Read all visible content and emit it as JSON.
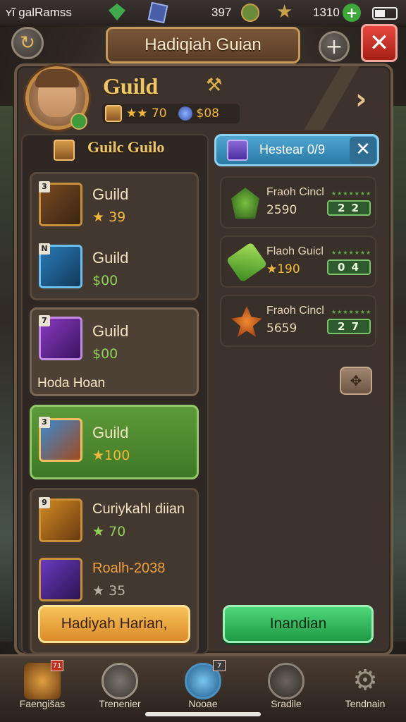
{
  "status_bar": {
    "app_name": "ʏĩ galRamss",
    "stat1": "397",
    "stat2": "1310"
  },
  "header": {
    "title": "Hadiqiah Guian"
  },
  "profile": {
    "title": "Guild",
    "stars_value": "★★ 70",
    "coins_value": "$08"
  },
  "left_section": {
    "heading": "Guilc Guilo",
    "items": [
      {
        "level": "3",
        "name": "Guild",
        "price": "★ 39"
      },
      {
        "level": "N",
        "name": "Guild",
        "price": "$00"
      },
      {
        "level": "7",
        "name": "Guild",
        "price": "$00",
        "subtitle": "Hoda Hoan"
      },
      {
        "level": "3",
        "name": "Guild",
        "price": "★100"
      },
      {
        "level": "9",
        "name": "Curiykahl diian",
        "price": "★ 70"
      },
      {
        "level": "",
        "name": "Roalh-2038",
        "price": "★ 35"
      }
    ],
    "button_label": "Hadiyah Harian,"
  },
  "right_section": {
    "tab_label": "Hestear 0/9",
    "rows": [
      {
        "name": "Fraoh Cincl",
        "value": "2590",
        "badge": "2 2"
      },
      {
        "name": "Flaoh Guicl",
        "value": "★190",
        "badge": "0 4"
      },
      {
        "name": "Fraoh Cincl",
        "value": "5659",
        "badge": "2 7"
      }
    ],
    "button_label": "Inandian"
  },
  "bottom_nav": [
    {
      "label": "Faengišas",
      "badge": "71",
      "icon": "sword-icon"
    },
    {
      "label": "Trenenier",
      "badge": "",
      "icon": "crossed-swords-icon"
    },
    {
      "label": "Nooae",
      "badge": "7",
      "icon": "globe-icon"
    },
    {
      "label": "Sradile",
      "badge": "",
      "icon": "clock-icon"
    },
    {
      "label": "Tendnain",
      "badge": "",
      "icon": "gear-icon"
    }
  ],
  "colors": {
    "gold": "#f2b93c",
    "green_button": "#1f9a46",
    "orange_button": "#dc8a2a",
    "close_red": "#d33a2f",
    "tab_blue": "#2b7aa6"
  }
}
